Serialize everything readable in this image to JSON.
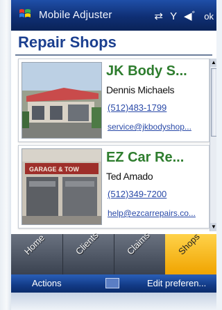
{
  "status_bar": {
    "app_title": "Mobile Adjuster",
    "icons": [
      "sync-icon",
      "signal-icon",
      "speaker-icon"
    ],
    "ok_label": "ok"
  },
  "page": {
    "title": "Repair Shops"
  },
  "shops": [
    {
      "name": "JK Body S...",
      "contact": "Dennis Michaels",
      "phone": "(512)483-1799",
      "email": "service@jkbodyshop..."
    },
    {
      "name": "EZ Car Re...",
      "contact": "Ted Amado",
      "phone": "(512)349-7200",
      "email": "help@ezcarrepairs.co..."
    }
  ],
  "tabs": [
    {
      "label": "Home",
      "active": false
    },
    {
      "label": "Clients",
      "active": false
    },
    {
      "label": "Claims",
      "active": false
    },
    {
      "label": "Shops",
      "active": true
    }
  ],
  "softkeys": {
    "left": "Actions",
    "right": "Edit preferen..."
  },
  "colors": {
    "status_bar": "#0f2f74",
    "title": "#1b3f8f",
    "shop_name": "#2e7d2e",
    "link": "#2a4aa8",
    "active_tab": "#f0a400"
  }
}
